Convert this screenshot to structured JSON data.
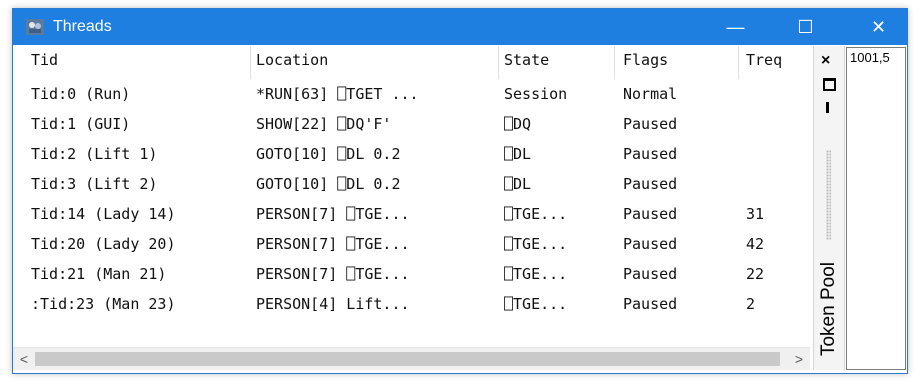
{
  "window": {
    "title": "Threads",
    "icon": "threads-app-icon",
    "controls": {
      "minimize": "—",
      "maximize": "☐",
      "close": "✕"
    }
  },
  "grid": {
    "headers": [
      "Tid",
      "Location",
      "State",
      "Flags",
      "Treq"
    ],
    "rows": [
      [
        "Tid:0 (Run)",
        "*RUN[63] ⎕TGET ...",
        "Session",
        "Normal",
        ""
      ],
      [
        "Tid:1 (GUI)",
        " SHOW[22] ⎕DQ'F'",
        "⎕DQ",
        "Paused",
        ""
      ],
      [
        "Tid:2 (Lift 1)",
        " GOTO[10] ⎕DL 0.2",
        "⎕DL",
        "Paused",
        ""
      ],
      [
        "Tid:3 (Lift 2)",
        " GOTO[10] ⎕DL 0.2",
        "⎕DL",
        "Paused",
        ""
      ],
      [
        "Tid:14 (Lady 14)",
        " PERSON[7] ⎕TGE...",
        "⎕TGE...",
        "Paused",
        "31"
      ],
      [
        "Tid:20 (Lady 20)",
        " PERSON[7] ⎕TGE...",
        "⎕TGE...",
        "Paused",
        "42"
      ],
      [
        "Tid:21 (Man 21)",
        " PERSON[7] ⎕TGE...",
        "⎕TGE...",
        "Paused",
        "22"
      ],
      [
        ":Tid:23 (Man 23)",
        " PERSON[4] Lift...",
        "⎕TGE...",
        "Paused",
        "2"
      ]
    ]
  },
  "scrollbar": {
    "left_arrow": "<",
    "right_arrow": ">"
  },
  "token_pool": {
    "label": "Token Pool",
    "close": "×",
    "value": "1001,5"
  }
}
